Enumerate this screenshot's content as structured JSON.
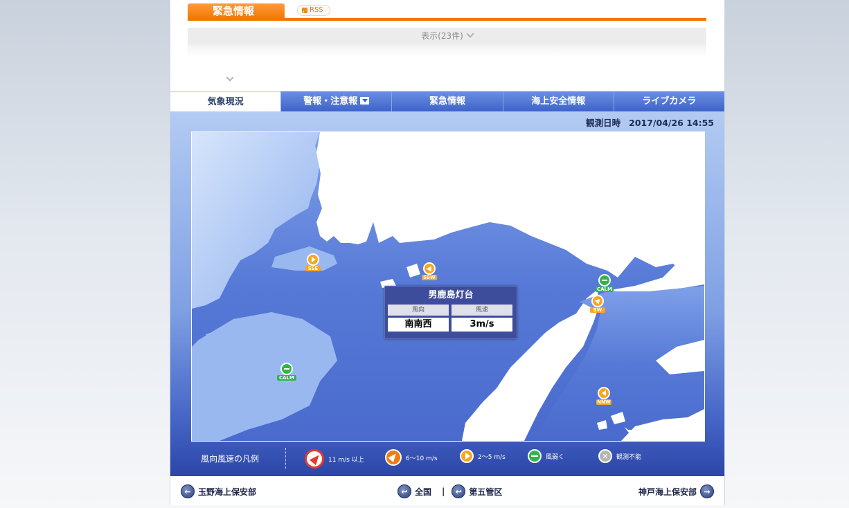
{
  "emergency": {
    "title": "緊急情報",
    "rss_label": "RSS",
    "toggle_label": "表示(23件)"
  },
  "tabs": [
    {
      "label": "気象現況",
      "active": true
    },
    {
      "label": "警報・注意報",
      "active": false,
      "has_dropdown": true
    },
    {
      "label": "緊急情報",
      "active": false
    },
    {
      "label": "海上安全情報",
      "active": false
    },
    {
      "label": "ライブカメラ",
      "active": false
    }
  ],
  "observation": {
    "label": "観測日時",
    "datetime": "2017/04/26 14:55"
  },
  "stations": [
    {
      "code": "SSE",
      "icon": "arrow-2-5-icon"
    },
    {
      "code": "SSW",
      "icon": "arrow-2-5-icon"
    },
    {
      "code": "CALM",
      "icon": "calm-icon"
    },
    {
      "code": "SW",
      "icon": "arrow-2-5-icon"
    },
    {
      "code": "CALM",
      "icon": "calm-icon"
    },
    {
      "code": "NNW",
      "icon": "arrow-2-5-icon"
    }
  ],
  "popup": {
    "title": "男鹿島灯台",
    "dir_header": "風向",
    "speed_header": "風速",
    "dir_value": "南南西",
    "speed_value": "3m/s"
  },
  "legend": {
    "title": "風向風速の凡例",
    "items": [
      {
        "label": "11 m/s 以上",
        "color": "#e63a2e",
        "icon": "arrow-11-icon"
      },
      {
        "label": "6〜10 m/s",
        "color": "#f07c15",
        "icon": "arrow-6-10-icon"
      },
      {
        "label": "2〜5 m/s",
        "color": "#f5a623",
        "icon": "arrow-2-5-icon"
      },
      {
        "label": "風弱く",
        "color": "#32b44a",
        "icon": "calm-icon"
      },
      {
        "label": "観測不能",
        "color": "#b5b5b5",
        "icon": "unavailable-icon"
      }
    ]
  },
  "footer": {
    "prev": "玉野海上保安部",
    "all": "全国",
    "separator": "|",
    "region": "第五管区",
    "next": "神戸海上保安部"
  }
}
